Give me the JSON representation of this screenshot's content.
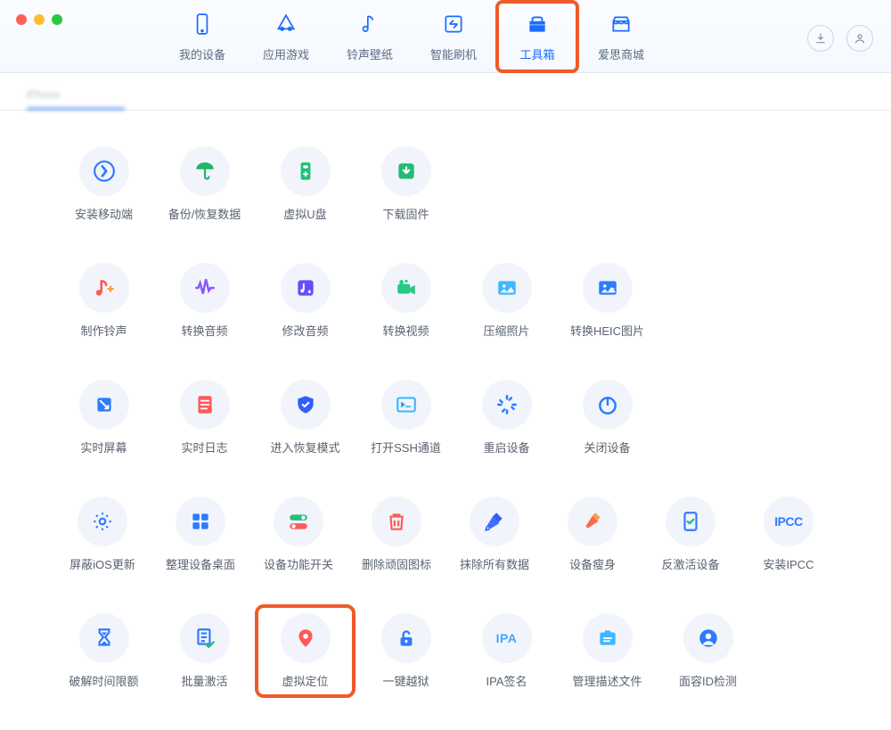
{
  "nav": {
    "items": [
      {
        "label": "我的设备"
      },
      {
        "label": "应用游戏"
      },
      {
        "label": "铃声壁纸"
      },
      {
        "label": "智能刷机"
      },
      {
        "label": "工具箱"
      },
      {
        "label": "爱思商城"
      }
    ]
  },
  "subtab": {
    "device_name": "iPhone"
  },
  "tools": {
    "row1": [
      {
        "label": "安装移动端"
      },
      {
        "label": "备份/恢复数据"
      },
      {
        "label": "虚拟U盘"
      },
      {
        "label": "下载固件"
      }
    ],
    "row2": [
      {
        "label": "制作铃声"
      },
      {
        "label": "转换音频"
      },
      {
        "label": "修改音频"
      },
      {
        "label": "转换视频"
      },
      {
        "label": "压缩照片"
      },
      {
        "label": "转换HEIC图片"
      }
    ],
    "row3": [
      {
        "label": "实时屏幕"
      },
      {
        "label": "实时日志"
      },
      {
        "label": "进入恢复模式"
      },
      {
        "label": "打开SSH通道"
      },
      {
        "label": "重启设备"
      },
      {
        "label": "关闭设备"
      }
    ],
    "row4": [
      {
        "label": "屏蔽iOS更新"
      },
      {
        "label": "整理设备桌面"
      },
      {
        "label": "设备功能开关"
      },
      {
        "label": "删除顽固图标"
      },
      {
        "label": "抹除所有数据"
      },
      {
        "label": "设备瘦身"
      },
      {
        "label": "反激活设备"
      },
      {
        "label": "安装IPCC",
        "ipcc": "IPCC"
      }
    ],
    "row5": [
      {
        "label": "破解时间限额"
      },
      {
        "label": "批量激活"
      },
      {
        "label": "虚拟定位"
      },
      {
        "label": "一键越狱"
      },
      {
        "label": "IPA签名",
        "ipa": "IPA"
      },
      {
        "label": "管理描述文件"
      },
      {
        "label": "面容ID检测"
      }
    ]
  }
}
